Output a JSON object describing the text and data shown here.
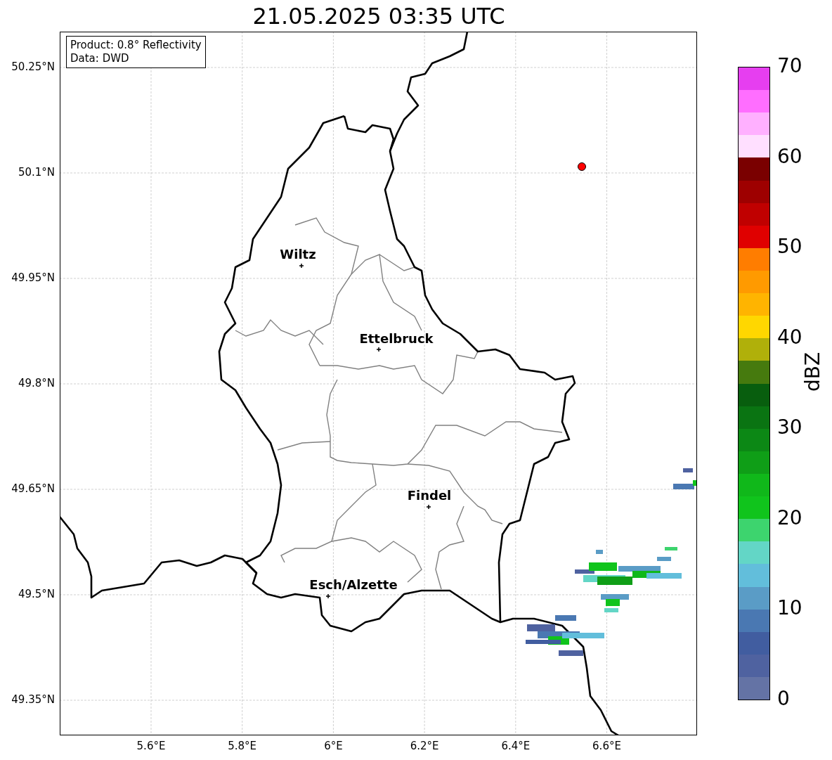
{
  "title": "21.05.2025 03:35 UTC",
  "info_box": [
    "Product: 0.8° Reflectivity",
    "Data: DWD"
  ],
  "map": {
    "lat_ticks": [
      "50.25°N",
      "50.1°N",
      "49.95°N",
      "49.8°N",
      "49.65°N",
      "49.5°N",
      "49.35°N"
    ],
    "lon_ticks": [
      "5.6°E",
      "5.8°E",
      "6°E",
      "6.2°E",
      "6.4°E",
      "6.6°E"
    ],
    "cities": [
      {
        "name": "Wiltz"
      },
      {
        "name": "Ettelbruck"
      },
      {
        "name": "Findel"
      },
      {
        "name": "Esch/Alzette"
      }
    ],
    "marker": {
      "color": "#ff0000"
    }
  },
  "colorbar": {
    "label": "dBZ",
    "ticks": [
      "70",
      "60",
      "50",
      "40",
      "30",
      "20",
      "10",
      "0"
    ],
    "segments": [
      {
        "color": "#e63ef0"
      },
      {
        "color": "#ff6eff"
      },
      {
        "color": "#ffb0ff"
      },
      {
        "color": "#ffdfff"
      },
      {
        "color": "#7a0000"
      },
      {
        "color": "#9e0000"
      },
      {
        "color": "#c00000"
      },
      {
        "color": "#e00000"
      },
      {
        "color": "#ff7d00"
      },
      {
        "color": "#ff9a00"
      },
      {
        "color": "#ffb400"
      },
      {
        "color": "#ffd700"
      },
      {
        "color": "#b0b00a"
      },
      {
        "color": "#467a0e"
      },
      {
        "color": "#085e0e"
      },
      {
        "color": "#0a7412"
      },
      {
        "color": "#0c8815"
      },
      {
        "color": "#0f9e17"
      },
      {
        "color": "#10b81a"
      },
      {
        "color": "#10c41c"
      },
      {
        "color": "#3dd46e"
      },
      {
        "color": "#63d6c6"
      },
      {
        "color": "#62bedb"
      },
      {
        "color": "#5a9cc6"
      },
      {
        "color": "#4a78b2"
      },
      {
        "color": "#415da0"
      },
      {
        "color": "#4f62a0"
      },
      {
        "color": "#6473a5"
      }
    ]
  }
}
